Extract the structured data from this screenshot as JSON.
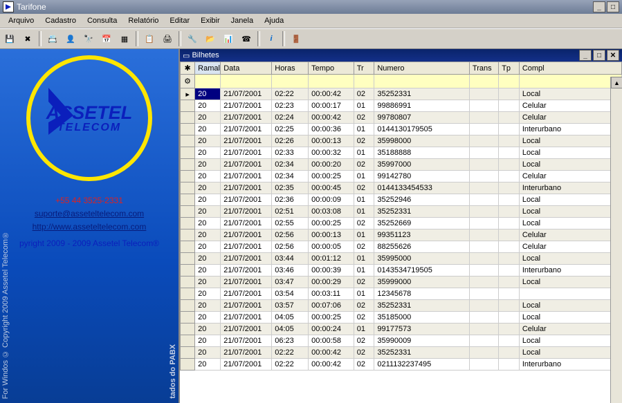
{
  "title": "Tarifone",
  "menubar": [
    "Arquivo",
    "Cadastro",
    "Consulta",
    "Relatório",
    "Editar",
    "Exibir",
    "Janela",
    "Ajuda"
  ],
  "sidebar": {
    "logo_line1": "ASSETEL",
    "logo_line2": "TELECOM",
    "phone": "+55 44 3525-2331",
    "email": "suporte@asseteltelecom.com",
    "site": "http://www.asseteltelecom.com",
    "copyright": "pyright 2009 - 2009 Assetel Telecom®",
    "vtext_left": "For Windos   © Copyright 2009   Assetel Telecom®",
    "vtext_right": "tados do PABX"
  },
  "child": {
    "title": "Bilhetes",
    "columns": [
      "Ramal",
      "Data",
      "Horas",
      "Tempo",
      "Tr",
      "Numero",
      "Trans",
      "Tp",
      "Compl"
    ],
    "rows": [
      {
        "ramal": "20",
        "data": "21/07/2001",
        "horas": "02:22",
        "tempo": "00:00:42",
        "tr": "02",
        "numero": "35252331",
        "trans": "",
        "tp": "",
        "compl": "Local"
      },
      {
        "ramal": "20",
        "data": "21/07/2001",
        "horas": "02:23",
        "tempo": "00:00:17",
        "tr": "01",
        "numero": "99886991",
        "trans": "",
        "tp": "",
        "compl": "Celular"
      },
      {
        "ramal": "20",
        "data": "21/07/2001",
        "horas": "02:24",
        "tempo": "00:00:42",
        "tr": "02",
        "numero": "99780807",
        "trans": "",
        "tp": "",
        "compl": "Celular"
      },
      {
        "ramal": "20",
        "data": "21/07/2001",
        "horas": "02:25",
        "tempo": "00:00:36",
        "tr": "01",
        "numero": "0144130179505",
        "trans": "",
        "tp": "",
        "compl": "Interurbano"
      },
      {
        "ramal": "20",
        "data": "21/07/2001",
        "horas": "02:26",
        "tempo": "00:00:13",
        "tr": "02",
        "numero": "35998000",
        "trans": "",
        "tp": "",
        "compl": "Local"
      },
      {
        "ramal": "20",
        "data": "21/07/2001",
        "horas": "02:33",
        "tempo": "00:00:32",
        "tr": "01",
        "numero": "35188888",
        "trans": "",
        "tp": "",
        "compl": "Local"
      },
      {
        "ramal": "20",
        "data": "21/07/2001",
        "horas": "02:34",
        "tempo": "00:00:20",
        "tr": "02",
        "numero": "35997000",
        "trans": "",
        "tp": "",
        "compl": "Local"
      },
      {
        "ramal": "20",
        "data": "21/07/2001",
        "horas": "02:34",
        "tempo": "00:00:25",
        "tr": "01",
        "numero": "99142780",
        "trans": "",
        "tp": "",
        "compl": "Celular"
      },
      {
        "ramal": "20",
        "data": "21/07/2001",
        "horas": "02:35",
        "tempo": "00:00:45",
        "tr": "02",
        "numero": "0144133454533",
        "trans": "",
        "tp": "",
        "compl": "Interurbano"
      },
      {
        "ramal": "20",
        "data": "21/07/2001",
        "horas": "02:36",
        "tempo": "00:00:09",
        "tr": "01",
        "numero": "35252946",
        "trans": "",
        "tp": "",
        "compl": "Local"
      },
      {
        "ramal": "20",
        "data": "21/07/2001",
        "horas": "02:51",
        "tempo": "00:03:08",
        "tr": "01",
        "numero": "35252331",
        "trans": "",
        "tp": "",
        "compl": "Local"
      },
      {
        "ramal": "20",
        "data": "21/07/2001",
        "horas": "02:55",
        "tempo": "00:00:25",
        "tr": "02",
        "numero": "35252669",
        "trans": "",
        "tp": "",
        "compl": "Local"
      },
      {
        "ramal": "20",
        "data": "21/07/2001",
        "horas": "02:56",
        "tempo": "00:00:13",
        "tr": "01",
        "numero": "99351123",
        "trans": "",
        "tp": "",
        "compl": "Celular"
      },
      {
        "ramal": "20",
        "data": "21/07/2001",
        "horas": "02:56",
        "tempo": "00:00:05",
        "tr": "02",
        "numero": "88255626",
        "trans": "",
        "tp": "",
        "compl": "Celular"
      },
      {
        "ramal": "20",
        "data": "21/07/2001",
        "horas": "03:44",
        "tempo": "00:01:12",
        "tr": "01",
        "numero": "35995000",
        "trans": "",
        "tp": "",
        "compl": "Local"
      },
      {
        "ramal": "20",
        "data": "21/07/2001",
        "horas": "03:46",
        "tempo": "00:00:39",
        "tr": "01",
        "numero": "0143534719505",
        "trans": "",
        "tp": "",
        "compl": "Interurbano"
      },
      {
        "ramal": "20",
        "data": "21/07/2001",
        "horas": "03:47",
        "tempo": "00:00:29",
        "tr": "02",
        "numero": "35999000",
        "trans": "",
        "tp": "",
        "compl": "Local"
      },
      {
        "ramal": "20",
        "data": "21/07/2001",
        "horas": "03:54",
        "tempo": "00:03:11",
        "tr": "01",
        "numero": "12345678",
        "trans": "",
        "tp": "",
        "compl": ""
      },
      {
        "ramal": "20",
        "data": "21/07/2001",
        "horas": "03:57",
        "tempo": "00:07:06",
        "tr": "02",
        "numero": "35252331",
        "trans": "",
        "tp": "",
        "compl": "Local"
      },
      {
        "ramal": "20",
        "data": "21/07/2001",
        "horas": "04:05",
        "tempo": "00:00:25",
        "tr": "02",
        "numero": "35185000",
        "trans": "",
        "tp": "",
        "compl": "Local"
      },
      {
        "ramal": "20",
        "data": "21/07/2001",
        "horas": "04:05",
        "tempo": "00:00:24",
        "tr": "01",
        "numero": "99177573",
        "trans": "",
        "tp": "",
        "compl": "Celular"
      },
      {
        "ramal": "20",
        "data": "21/07/2001",
        "horas": "06:23",
        "tempo": "00:00:58",
        "tr": "02",
        "numero": "35990009",
        "trans": "",
        "tp": "",
        "compl": "Local"
      },
      {
        "ramal": "20",
        "data": "21/07/2001",
        "horas": "02:22",
        "tempo": "00:00:42",
        "tr": "02",
        "numero": "35252331",
        "trans": "",
        "tp": "",
        "compl": "Local"
      },
      {
        "ramal": "20",
        "data": "21/07/2001",
        "horas": "02:22",
        "tempo": "00:00:42",
        "tr": "02",
        "numero": "0211132237495",
        "trans": "",
        "tp": "",
        "compl": "Interurbano"
      }
    ]
  }
}
